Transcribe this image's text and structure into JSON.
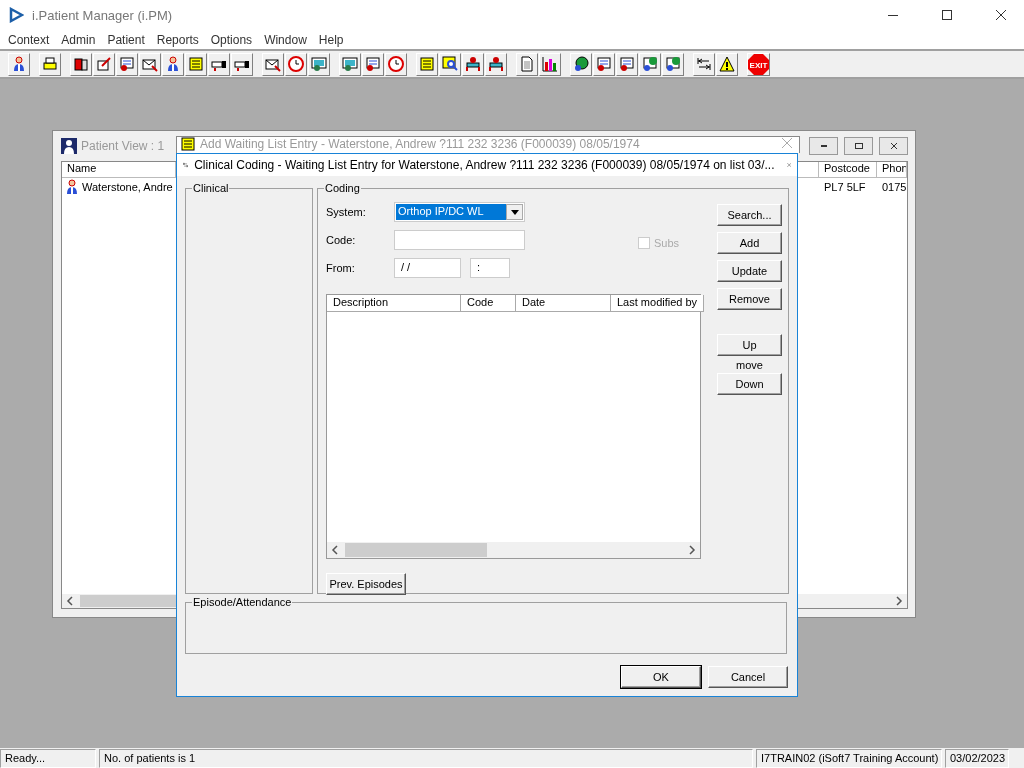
{
  "app": {
    "title": "i.Patient Manager (i.PM)"
  },
  "menu": [
    {
      "label": "Context"
    },
    {
      "label": "Admin"
    },
    {
      "label": "Patient"
    },
    {
      "label": "Reports"
    },
    {
      "label": "Options"
    },
    {
      "label": "Window"
    },
    {
      "label": "Help"
    }
  ],
  "toolbar": {
    "exit_label": "EXIT"
  },
  "patient_view": {
    "title": "Patient View : 1",
    "columns": [
      "Name",
      "Postcode",
      "Phon"
    ],
    "rows": [
      {
        "name": "Waterstone, Andre",
        "postcode": "PL7 5LF",
        "phone": "0175"
      }
    ]
  },
  "waiting_list_window": {
    "title": "Add Waiting List Entry - Waterstone, Andrew ?111 232 3236 (F000039) 08/05/1974"
  },
  "coding_dialog": {
    "title": "Clinical Coding - Waiting List Entry for Waterstone, Andrew ?111 232 3236 (F000039) 08/05/1974 on list 03/...",
    "clinical_label": "Clinical",
    "coding_label": "Coding",
    "system": {
      "label": "System:",
      "value": "Orthop IP/DC WL"
    },
    "code": {
      "label": "Code:"
    },
    "subs": {
      "label": "Subs",
      "checked": false,
      "disabled": true
    },
    "from": {
      "label": "From:",
      "date": "/ /",
      "time": ":"
    },
    "list_columns": [
      "Description",
      "Code",
      "Date",
      "Last modified by"
    ],
    "side_buttons": [
      {
        "label": "Search..."
      },
      {
        "label": "Add"
      },
      {
        "label": "Update"
      },
      {
        "label": "Remove"
      }
    ],
    "move": {
      "up": "Up",
      "label": "move",
      "down": "Down"
    },
    "prev_button": "Prev. Episodes",
    "episode_label": "Episode/Attendance",
    "buttons": [
      {
        "label": "OK"
      },
      {
        "label": "Cancel"
      }
    ]
  },
  "status_bar": [
    "Ready...",
    "No. of patients is 1",
    "I7TRAIN02 (iSoft7 Training Account)",
    "03/02/2023"
  ]
}
